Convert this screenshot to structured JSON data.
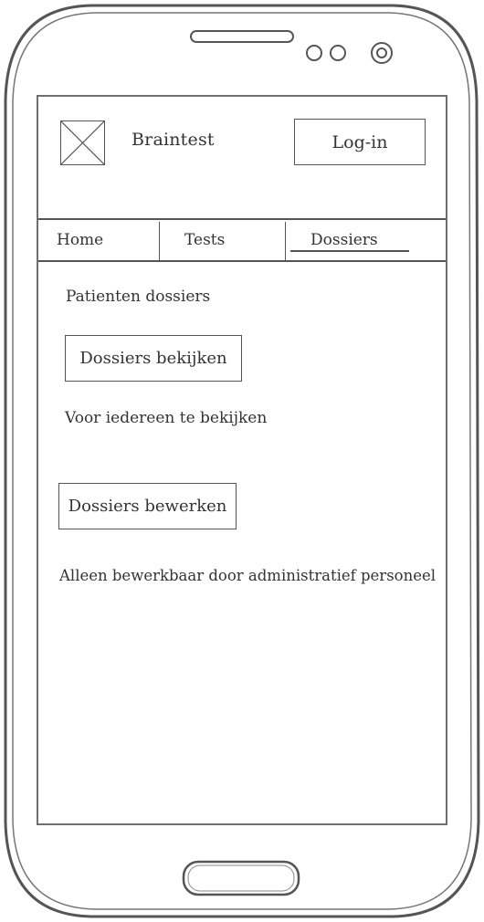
{
  "header": {
    "app_title": "Braintest",
    "login_label": "Log-in"
  },
  "nav": {
    "tabs": [
      {
        "label": "Home",
        "active": false
      },
      {
        "label": "Tests",
        "active": false
      },
      {
        "label": "Dossiers",
        "active": true
      }
    ]
  },
  "main": {
    "section_title": "Patienten dossiers",
    "view_button_label": "Dossiers bekijken",
    "view_note": "Voor iedereen te bekijken",
    "edit_button_label": "Dossiers bewerken",
    "edit_note": "Alleen bewerkbaar door administratief personeel"
  },
  "icons": {
    "logo": "image-placeholder-icon",
    "speaker": "speaker-icon",
    "camera": "camera-icon",
    "sensor": "sensor-icon",
    "home_button": "home-button-icon"
  },
  "colors": {
    "stroke": "#555555",
    "text": "#333333",
    "background": "#ffffff"
  }
}
